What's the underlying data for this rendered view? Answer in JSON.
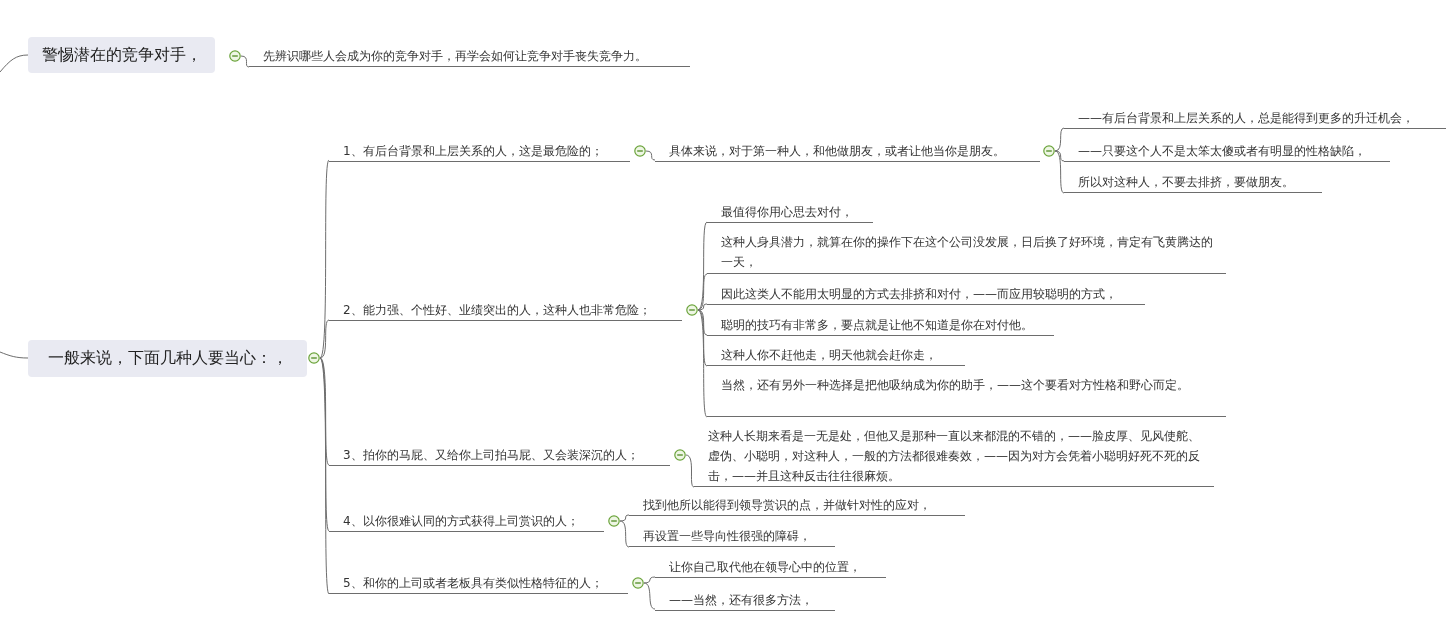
{
  "topics": [
    {
      "label": "警惕潜在的竞争对手，",
      "expanded": true,
      "children": [
        {
          "text": "先辨识哪些人会成为你的竞争对手，再学会如何让竞争对手丧失竞争力。"
        }
      ]
    },
    {
      "label": "一般来说，下面几种人要当心：，",
      "expanded": true,
      "children": [
        {
          "text": "1、有后台背景和上层关系的人，这是最危险的；",
          "expanded": true,
          "children": [
            {
              "text": "具体来说，对于第一种人，和他做朋友，或者让他当你是朋友。",
              "expanded": true,
              "children": [
                {
                  "text": "——有后台背景和上层关系的人，总是能得到更多的升迁机会，"
                },
                {
                  "text": "——只要这个人不是太笨太傻或者有明显的性格缺陷，"
                },
                {
                  "text": "所以对这种人，不要去排挤，要做朋友。"
                }
              ]
            }
          ]
        },
        {
          "text": "2、能力强、个性好、业绩突出的人，这种人也非常危险；",
          "expanded": true,
          "children": [
            {
              "text": "最值得你用心思去对付，"
            },
            {
              "text": "这种人身具潜力，就算在你的操作下在这个公司没发展，日后换了好环境，肯定有飞黄腾达的一天，"
            },
            {
              "text": "因此这类人不能用太明显的方式去排挤和对付，——而应用较聪明的方式，"
            },
            {
              "text": "聪明的技巧有非常多，要点就是让他不知道是你在对付他。"
            },
            {
              "text": "这种人你不赶他走，明天他就会赶你走，"
            },
            {
              "text": "当然，还有另外一种选择是把他吸纳成为你的助手，——这个要看对方性格和野心而定。"
            }
          ]
        },
        {
          "text": "3、拍你的马屁、又给你上司拍马屁、又会装深沉的人；",
          "expanded": true,
          "children": [
            {
              "text": "这种人长期来看是一无是处，但他又是那种一直以来都混的不错的，——脸皮厚、见风使舵、虚伪、小聪明，对这种人，一般的方法都很难奏效，——因为对方会凭着小聪明好死不死的反击，——并且这种反击往往很麻烦。"
            }
          ]
        },
        {
          "text": "4、以你很难认同的方式获得上司赏识的人；",
          "expanded": true,
          "children": [
            {
              "text": "找到他所以能得到领导赏识的点，并做针对性的应对，"
            },
            {
              "text": "再设置一些导向性很强的障碍，"
            }
          ]
        },
        {
          "text": "5、和你的上司或者老板具有类似性格特征的人；",
          "expanded": true,
          "children": [
            {
              "text": "让你自己取代他在领导心中的位置，"
            },
            {
              "text": "——当然，还有很多方法，"
            }
          ]
        }
      ]
    }
  ]
}
